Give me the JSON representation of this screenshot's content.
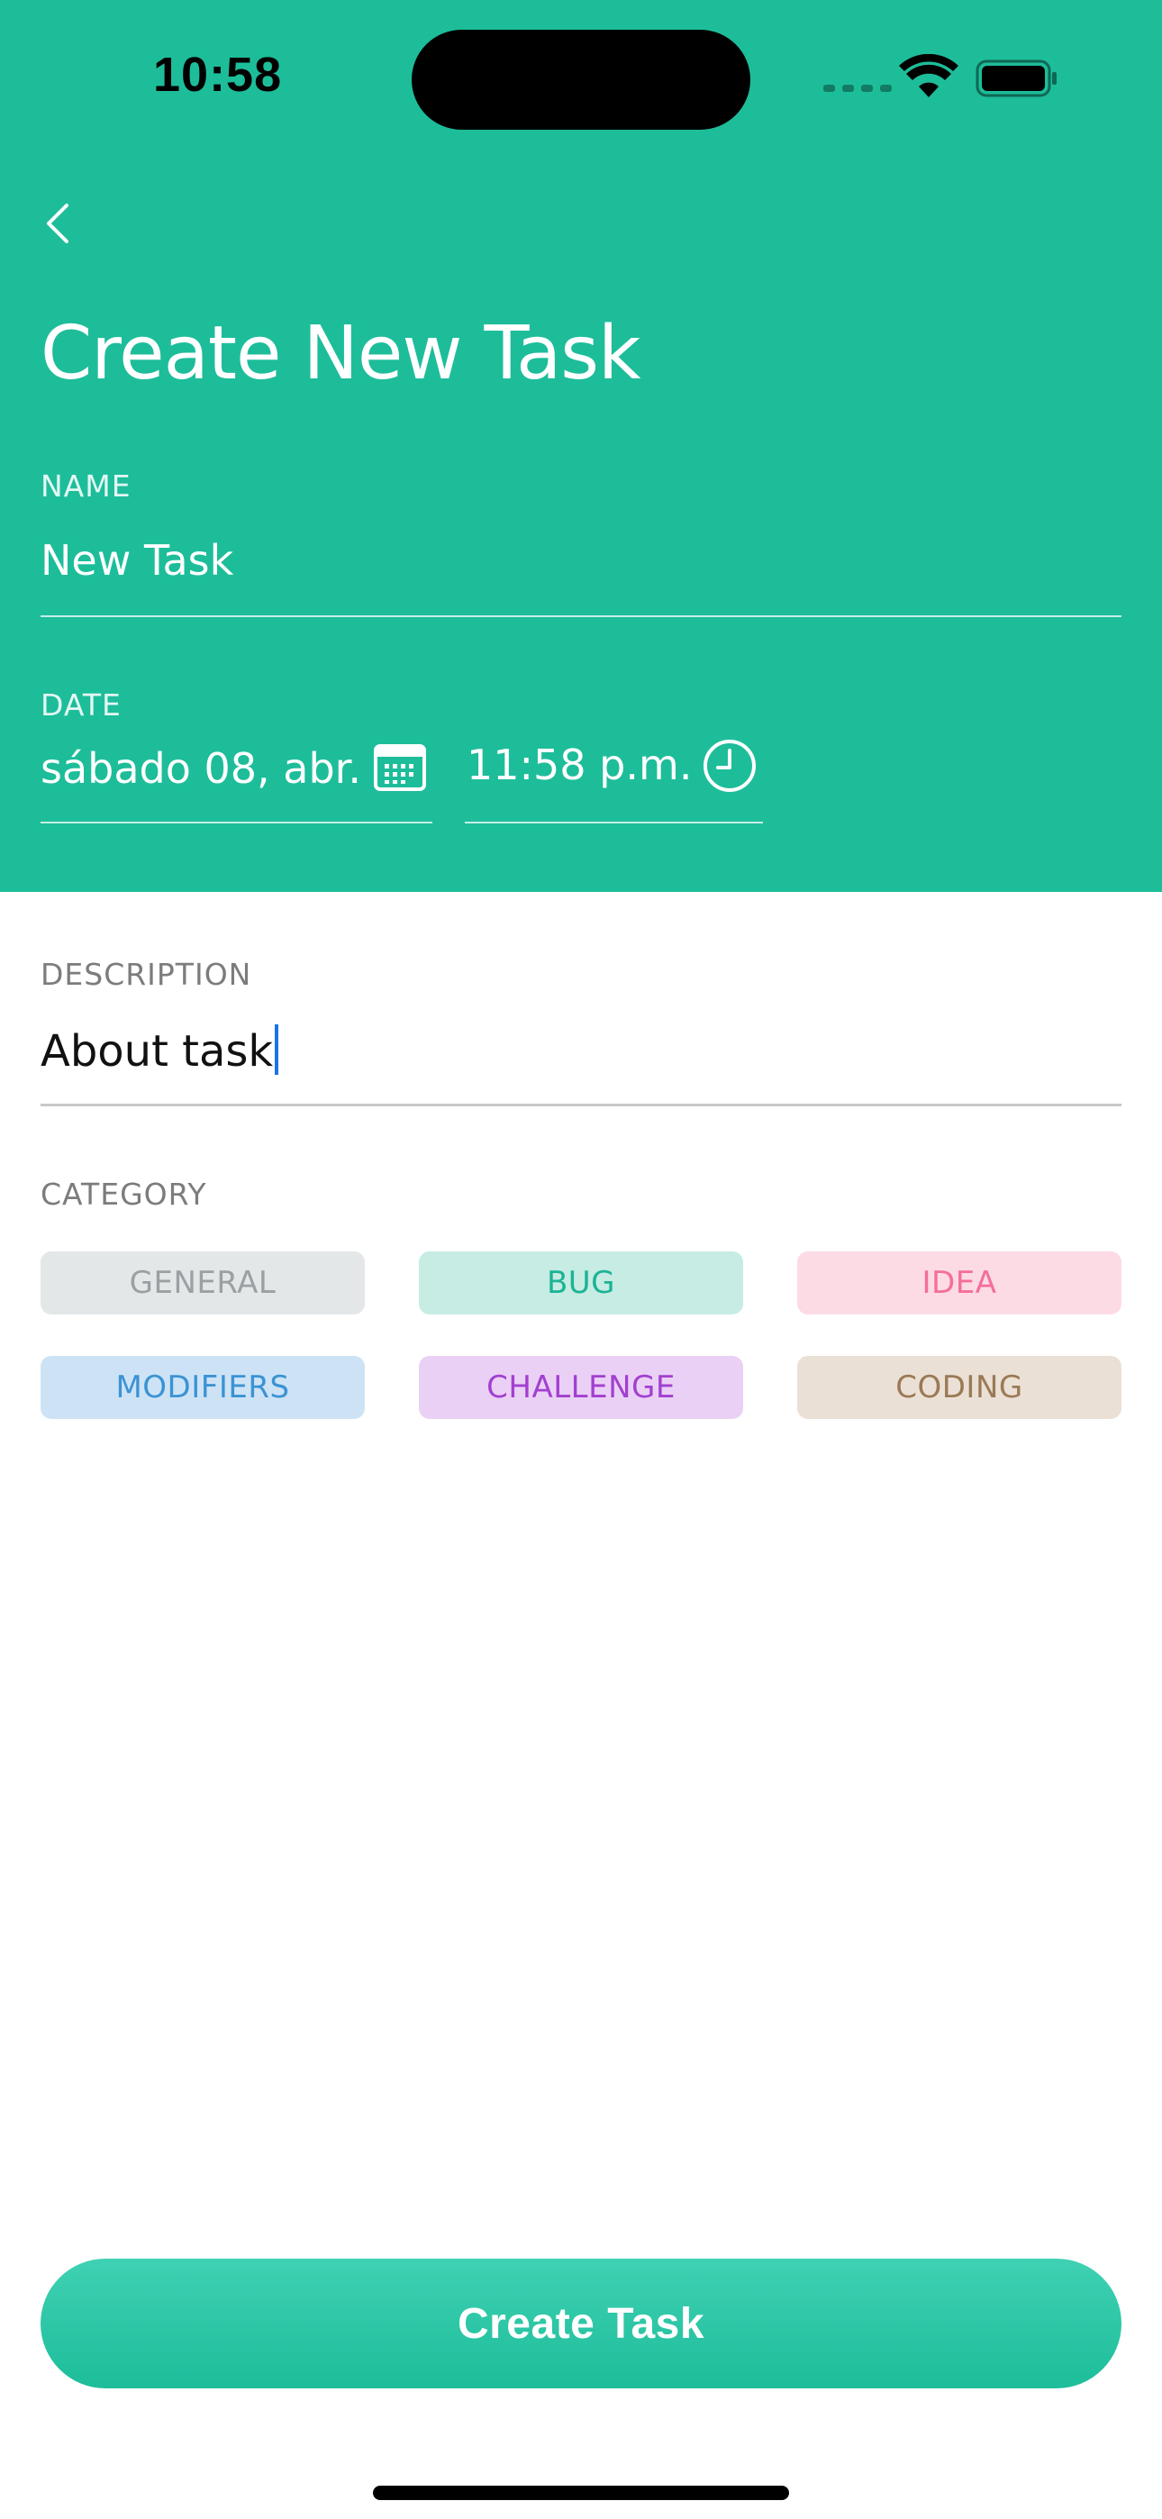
{
  "status_bar": {
    "time": "10:58"
  },
  "header": {
    "title": "Create New Task"
  },
  "form": {
    "name": {
      "label": "NAME",
      "value": "New Task"
    },
    "date": {
      "label": "DATE",
      "date_value": "sábado 08, abr.",
      "time_value": "11:58 p.m."
    },
    "description": {
      "label": "DESCRIPTION",
      "value": "About task"
    },
    "category": {
      "label": "CATEGORY",
      "chips": [
        {
          "label": "GENERAL",
          "bg": "#e4e7e8",
          "color": "#9aa0a3"
        },
        {
          "label": "BUG",
          "bg": "#c6ece3",
          "color": "#1bb394"
        },
        {
          "label": "IDEA",
          "bg": "#fddbe5",
          "color": "#f46e9b"
        },
        {
          "label": "MODIFIERS",
          "bg": "#cde3f5",
          "color": "#3b93d4"
        },
        {
          "label": "CHALLENGE",
          "bg": "#ead0f5",
          "color": "#a240d0"
        },
        {
          "label": "CODING",
          "bg": "#ebe0d5",
          "color": "#9a7a55"
        }
      ]
    }
  },
  "actions": {
    "create_label": "Create Task"
  },
  "colors": {
    "accent": "#1dbd9a"
  }
}
